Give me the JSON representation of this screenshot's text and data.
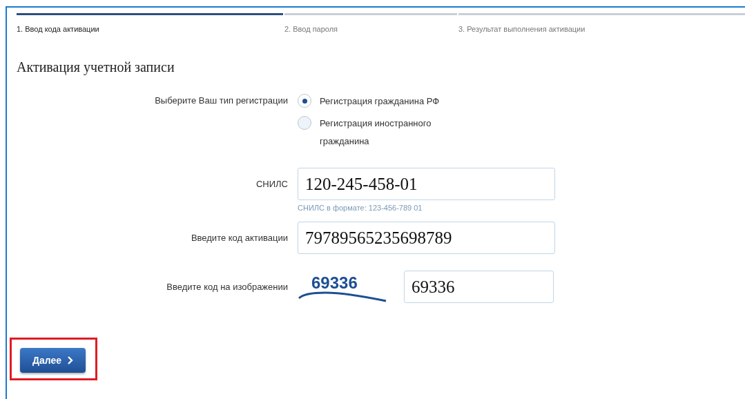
{
  "steps": [
    {
      "label": "1. Ввод кода активации",
      "selected": true
    },
    {
      "label": "2. Ввод пароля",
      "selected": false
    },
    {
      "label": "3. Результат выполнения активации",
      "selected": false
    }
  ],
  "title": "Активация учетной записи",
  "registration": {
    "label": "Выберите Ваш тип регистрации",
    "options": [
      {
        "label": "Регистрация гражданина РФ",
        "selected": true
      },
      {
        "label": "Регистрация иностранного гражданина",
        "selected": false
      }
    ]
  },
  "snils": {
    "label": "СНИЛС",
    "value": "120-245-458-01",
    "hint": "СНИЛС в формате: 123-456-789 01"
  },
  "activation_code": {
    "label": "Введите код активации",
    "value": "79789565235698789"
  },
  "captcha": {
    "label": "Введите код на изображении",
    "image_text": "69336",
    "value": "69336"
  },
  "next_button": {
    "label": "Далее",
    "highlighted": true
  }
}
